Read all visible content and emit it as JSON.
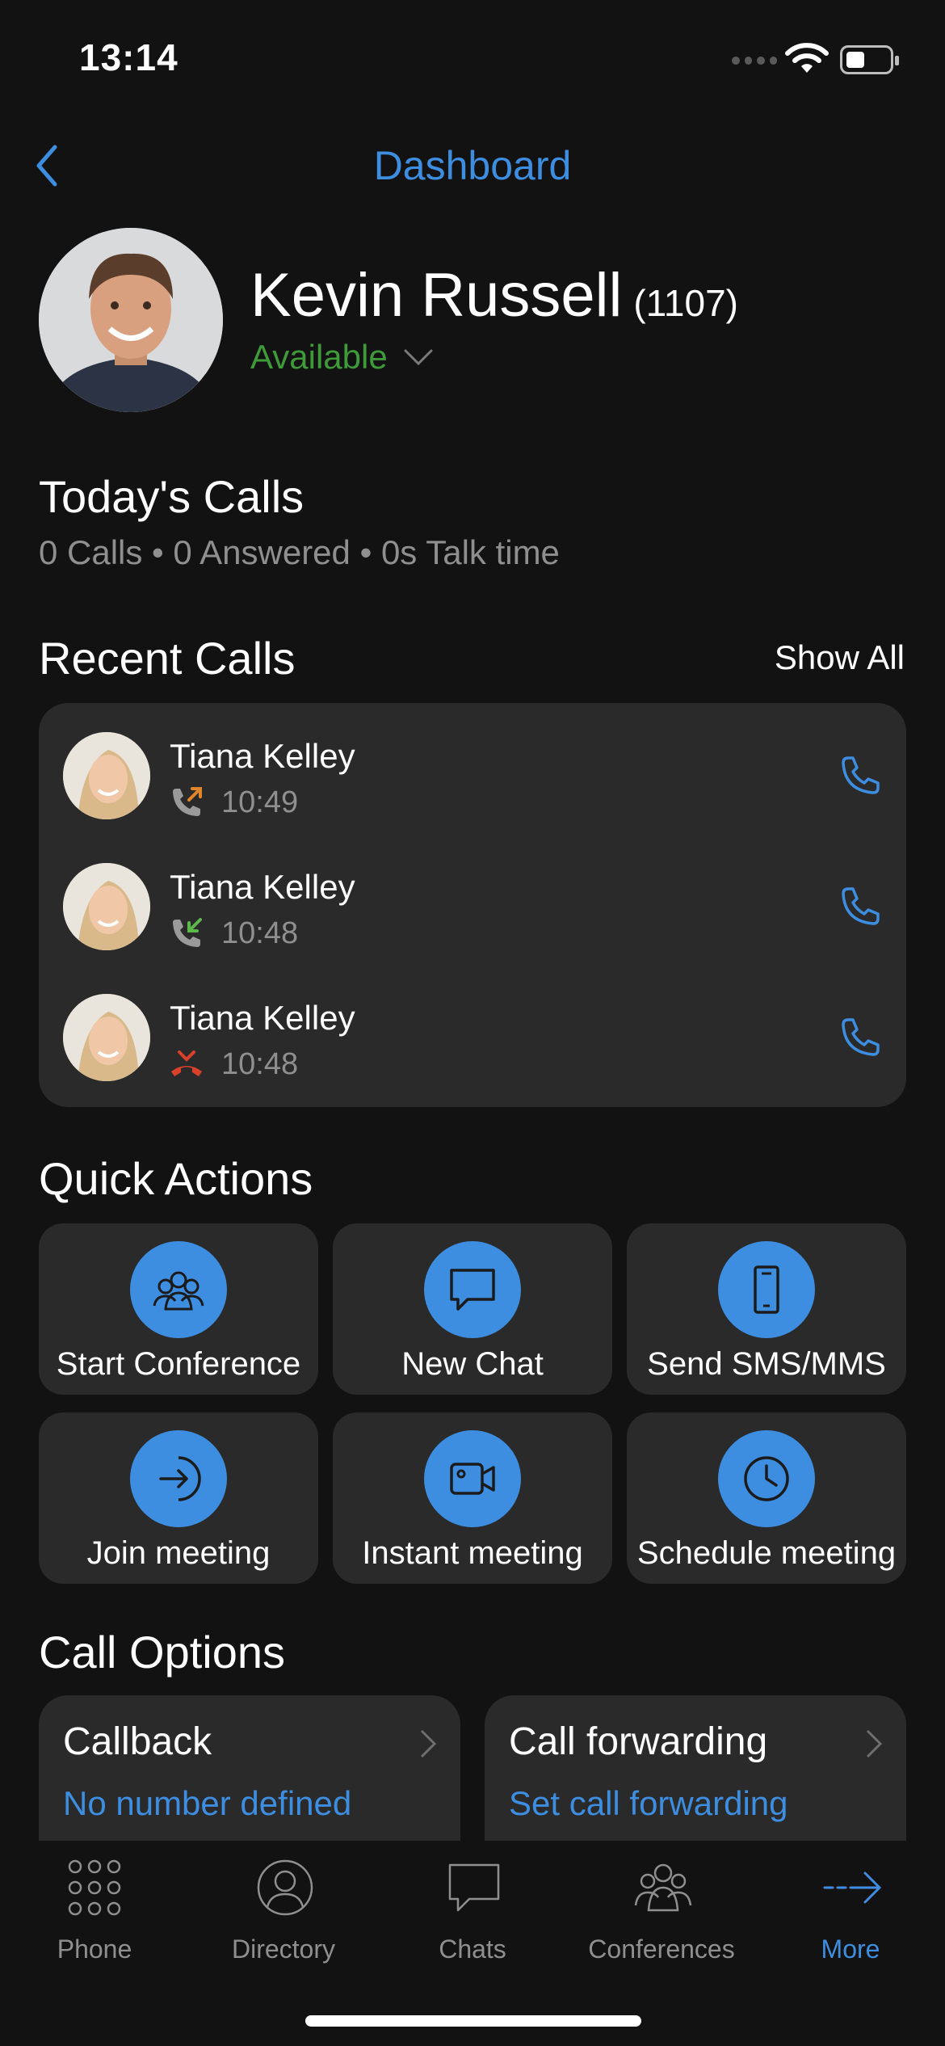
{
  "status_bar": {
    "time": "13:14"
  },
  "header": {
    "title": "Dashboard"
  },
  "profile": {
    "name": "Kevin Russell",
    "extension": "(1107)",
    "presence": "Available"
  },
  "todays_calls": {
    "title": "Today's Calls",
    "summary": "0 Calls • 0 Answered • 0s Talk time"
  },
  "recent_calls": {
    "title": "Recent Calls",
    "show_all": "Show All",
    "items": [
      {
        "name": "Tiana Kelley",
        "time": "10:49",
        "direction": "outgoing"
      },
      {
        "name": "Tiana Kelley",
        "time": "10:48",
        "direction": "incoming"
      },
      {
        "name": "Tiana Kelley",
        "time": "10:48",
        "direction": "missed"
      }
    ]
  },
  "quick_actions": {
    "title": "Quick Actions",
    "items": [
      {
        "label": "Start Conference",
        "icon": "conference-icon"
      },
      {
        "label": "New Chat",
        "icon": "chat-bubble-icon"
      },
      {
        "label": "Send SMS/MMS",
        "icon": "mobile-phone-icon"
      },
      {
        "label": "Join meeting",
        "icon": "join-arrow-icon"
      },
      {
        "label": "Instant meeting",
        "icon": "video-camera-icon"
      },
      {
        "label": "Schedule meeting",
        "icon": "clock-icon"
      }
    ]
  },
  "call_options": {
    "title": "Call Options",
    "callback": {
      "title": "Callback",
      "value": "No number defined"
    },
    "forwarding": {
      "title": "Call forwarding",
      "value": "Set call forwarding"
    }
  },
  "tabbar": {
    "tabs": [
      {
        "label": "Phone",
        "icon": "dialpad-icon"
      },
      {
        "label": "Directory",
        "icon": "person-icon"
      },
      {
        "label": "Chats",
        "icon": "chat-icon"
      },
      {
        "label": "Conferences",
        "icon": "group-icon"
      },
      {
        "label": "More",
        "icon": "arrow-right-icon"
      }
    ],
    "active": "More"
  },
  "colors": {
    "accent": "#3d8ee0",
    "available": "#3f9b3a",
    "background": "#121212",
    "card": "#2a2a2a",
    "outgoing": "#e0852a",
    "incoming": "#5cb84a",
    "missed": "#d9412b"
  }
}
